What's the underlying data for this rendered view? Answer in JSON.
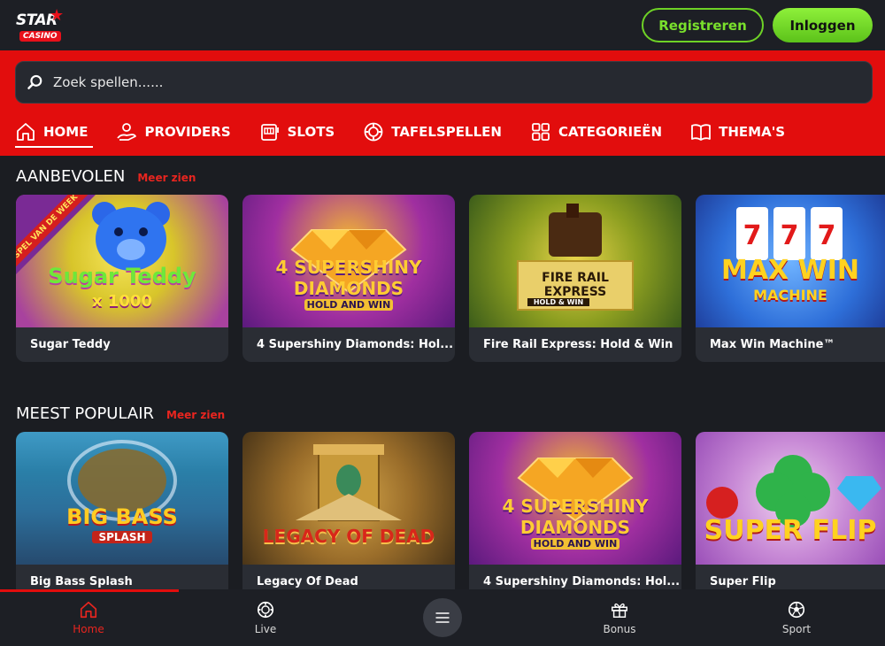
{
  "brand": {
    "name": "STAR",
    "sub": "CASINO"
  },
  "auth": {
    "register_label": "Registreren",
    "login_label": "Inloggen"
  },
  "search": {
    "placeholder": "Zoek spellen......"
  },
  "nav": {
    "tabs": [
      {
        "label": "HOME",
        "icon": "home-icon"
      },
      {
        "label": "PROVIDERS",
        "icon": "providers-icon"
      },
      {
        "label": "SLOTS",
        "icon": "slot-machine-icon"
      },
      {
        "label": "TAFELSPELLEN",
        "icon": "chip-icon"
      },
      {
        "label": "CATEGORIEËN",
        "icon": "grid-icon"
      },
      {
        "label": "THEMA'S",
        "icon": "book-icon"
      }
    ]
  },
  "sections": [
    {
      "title": "AANBEVOLEN",
      "more": "Meer zien",
      "games": [
        {
          "name": "Sugar Teddy",
          "art_title": "Sugar Teddy",
          "art_sub": "x 1000",
          "badge": "SPEL VAN DE WEEK"
        },
        {
          "name": "4 Supershiny Diamonds: Hol...",
          "art_title": "4 SUPERSHINY DIAMONDS",
          "art_sub": "HOLD AND WIN"
        },
        {
          "name": "Fire Rail Express: Hold & Win",
          "art_title": "FIRE RAIL EXPRESS",
          "art_sub": "HOLD & WIN"
        },
        {
          "name": "Max Win Machine™",
          "art_title": "MAX WIN",
          "art_sub": "MACHINE"
        }
      ]
    },
    {
      "title": "MEEST POPULAIR",
      "more": "Meer zien",
      "games": [
        {
          "name": "Big Bass Splash",
          "art_title": "BIG BASS",
          "art_sub": "SPLASH"
        },
        {
          "name": "Legacy Of Dead",
          "art_title": "LEGACY OF DEAD",
          "art_sub": ""
        },
        {
          "name": "4 Supershiny Diamonds: Hol...",
          "art_title": "4 SUPERSHINY DIAMONDS",
          "art_sub": "HOLD AND WIN"
        },
        {
          "name": "Super Flip",
          "art_title": "SUPER FLIP",
          "art_sub": ""
        }
      ]
    }
  ],
  "bottom_nav": {
    "home": "Home",
    "live": "Live",
    "bonus": "Bonus",
    "sport": "Sport"
  },
  "colors": {
    "accent_red": "#e20d0d",
    "accent_green": "#79e02c",
    "background": "#1b1d22"
  }
}
